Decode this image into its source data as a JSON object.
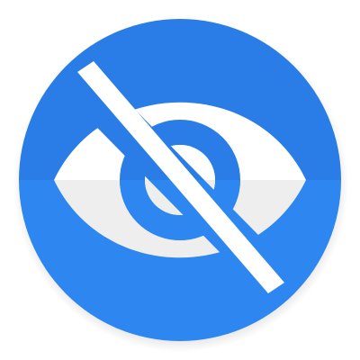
{
  "icon": {
    "name": "eye-off-icon",
    "colors": {
      "badge_upper": "#2a7de6",
      "badge_lower": "#2e86f0",
      "eye_upper": "#ffffff",
      "eye_lower": "#eeeeee",
      "strike": "#ffffff",
      "shadow": "#cfcfcf"
    }
  }
}
